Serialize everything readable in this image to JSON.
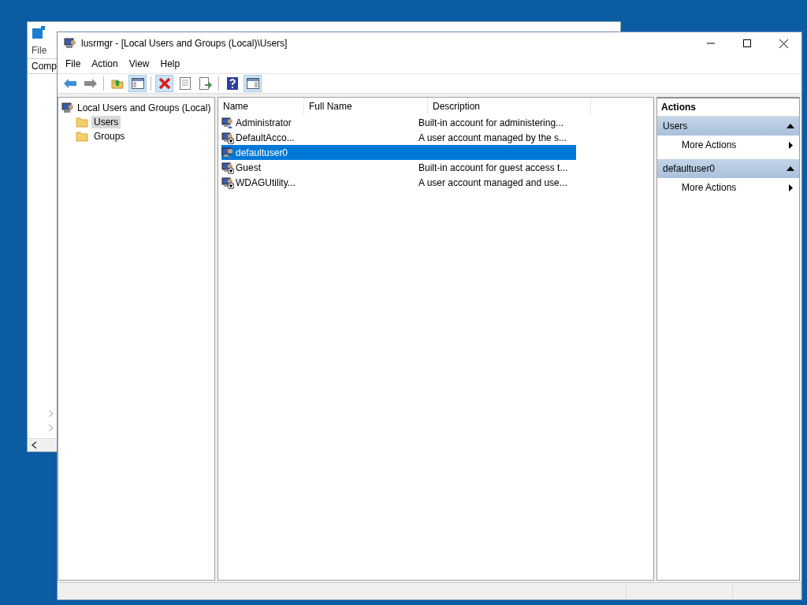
{
  "background_window": {
    "menu": [
      "File"
    ],
    "address": "Comp"
  },
  "window": {
    "title": "lusrmgr - [Local Users and Groups (Local)\\Users]"
  },
  "menu": [
    "File",
    "Action",
    "View",
    "Help"
  ],
  "toolbar": [
    {
      "kind": "back",
      "on": false
    },
    {
      "kind": "forward",
      "on": false
    },
    {
      "kind": "separator"
    },
    {
      "kind": "up",
      "on": false
    },
    {
      "kind": "tree",
      "on": true
    },
    {
      "kind": "separator"
    },
    {
      "kind": "delete",
      "on": true
    },
    {
      "kind": "properties",
      "on": false
    },
    {
      "kind": "export",
      "on": false
    },
    {
      "kind": "separator"
    },
    {
      "kind": "help",
      "on": false
    },
    {
      "kind": "actionpane",
      "on": true
    }
  ],
  "tree": {
    "label": "Local Users and Groups (Local)",
    "children": [
      {
        "label": "Users",
        "selected": true
      },
      {
        "label": "Groups",
        "selected": false
      }
    ]
  },
  "table": {
    "columns": [
      "Name",
      "Full Name",
      "Description"
    ],
    "rows": [
      {
        "name": "Administrator",
        "description": "Built-in account for administering...",
        "disabled": false,
        "selected": false
      },
      {
        "name": "DefaultAcco...",
        "description": "A user account managed by the s...",
        "disabled": true,
        "selected": false
      },
      {
        "name": "defaultuser0",
        "disabled": false,
        "selected": true
      },
      {
        "name": "Guest",
        "description": "Built-in account for guest access t...",
        "disabled": true,
        "selected": false
      },
      {
        "name": "WDAGUtility...",
        "description": "A user account managed and use...",
        "disabled": true,
        "selected": false
      }
    ]
  },
  "actions": {
    "title": "Actions",
    "sections": [
      {
        "title": "Users",
        "expanded": true,
        "items": [
          "More Actions"
        ]
      },
      {
        "title": "defaultuser0",
        "expanded": true,
        "items": [
          "More Actions"
        ]
      }
    ]
  }
}
